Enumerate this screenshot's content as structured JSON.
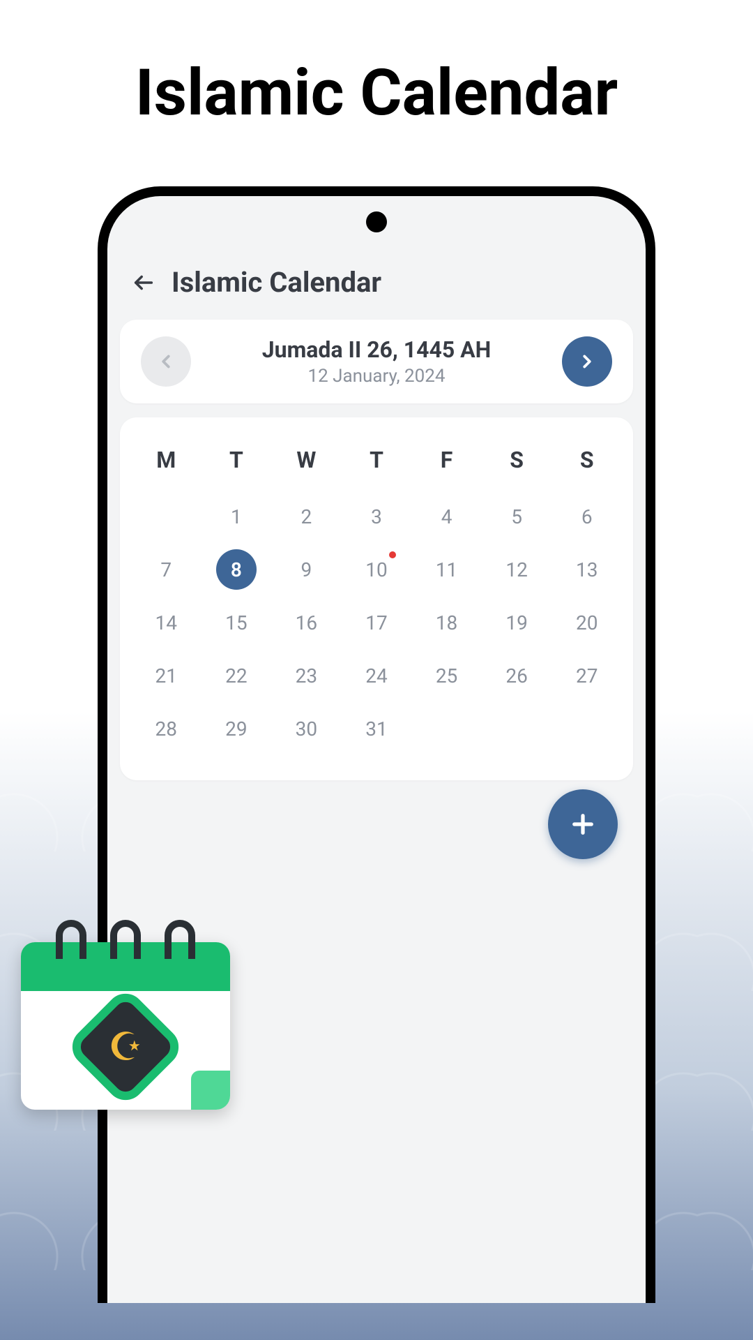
{
  "page_title": "Islamic Calendar",
  "app": {
    "title": "Islamic Calendar"
  },
  "date_nav": {
    "hijri": "Jumada II 26, 1445 AH",
    "gregorian": "12 January, 2024"
  },
  "calendar": {
    "dow": [
      "M",
      "T",
      "W",
      "T",
      "F",
      "S",
      "S"
    ],
    "weeks": [
      [
        null,
        1,
        2,
        3,
        4,
        5,
        6
      ],
      [
        7,
        8,
        9,
        10,
        11,
        12,
        13
      ],
      [
        14,
        15,
        16,
        17,
        18,
        19,
        20
      ],
      [
        21,
        22,
        23,
        24,
        25,
        26,
        27
      ],
      [
        28,
        29,
        30,
        31,
        null,
        null,
        null
      ]
    ],
    "selected_day": 8,
    "event_day": 10
  },
  "colors": {
    "accent": "#3e6697",
    "green": "#1abc6f"
  }
}
